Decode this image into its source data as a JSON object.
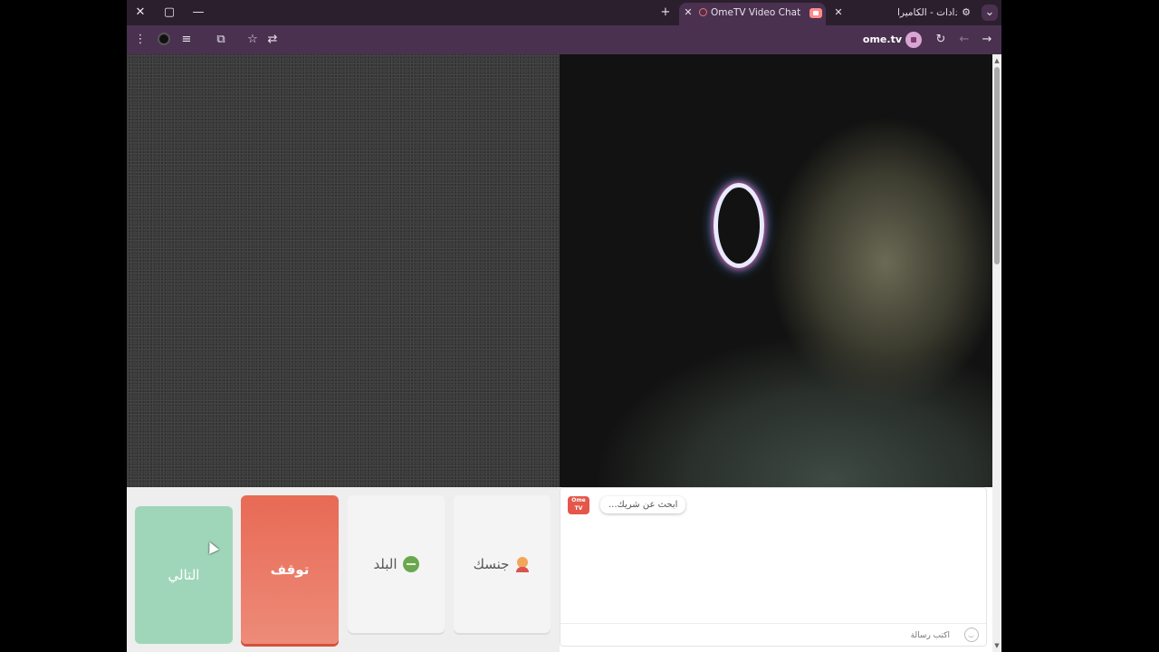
{
  "window_controls": {
    "close": "✕",
    "maximize": "▢",
    "minimize": "—"
  },
  "tabs": [
    {
      "title": "OmeTV Video Chat — Ome",
      "active": true
    },
    {
      "title": "الإعدادات - الكاميرا",
      "active": false
    }
  ],
  "new_tab_icon": "+",
  "toolbar": {
    "url": "ome.tv"
  },
  "controls": {
    "next_label": "التالي",
    "stop_label": "توقف",
    "country_label": "البلد",
    "gender_label": "جنسك"
  },
  "chat": {
    "logo_text": "Ome TV",
    "status_message": "...ابحث عن شريك",
    "input_placeholder": "اكتب رسالة"
  },
  "colors": {
    "tab_bar": "#2b1f2d",
    "toolbar": "#4a3150",
    "next_button": "#9fd6b9",
    "stop_button": "#e86a55",
    "logo": "#e4574a"
  }
}
